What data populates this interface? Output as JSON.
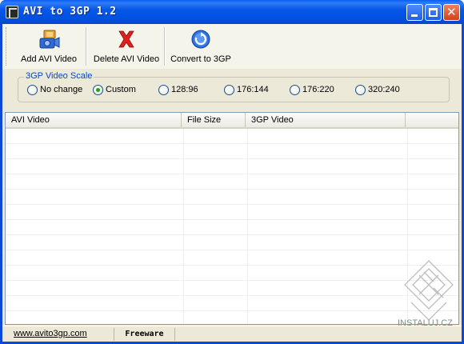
{
  "window": {
    "title": "AVI to 3GP 1.2"
  },
  "toolbar": {
    "add_label": "Add AVI Video",
    "delete_label": "Delete AVI Video",
    "convert_label": "Convert to 3GP"
  },
  "scale": {
    "title": "3GP Video Scale",
    "options": [
      {
        "label": "No change",
        "checked": false
      },
      {
        "label": "Custom",
        "checked": true
      },
      {
        "label": "128:96",
        "checked": false
      },
      {
        "label": "176:144",
        "checked": false
      },
      {
        "label": "176:220",
        "checked": false
      },
      {
        "label": "320:240",
        "checked": false
      }
    ]
  },
  "list": {
    "columns": [
      "AVI Video",
      "File Size",
      "3GP Video"
    ]
  },
  "statusbar": {
    "link": "www.avito3gp.com",
    "license": "Freeware"
  },
  "watermark": {
    "text": "INSTALUJ.CZ"
  },
  "colors": {
    "accent": "#0046d5",
    "checked_radio": "#21a121",
    "delete_icon": "#e0201c"
  }
}
